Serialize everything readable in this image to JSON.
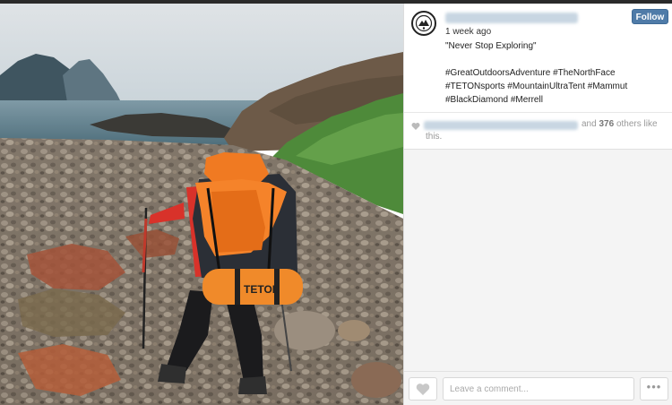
{
  "post": {
    "username": "",
    "follow_label": "Follow",
    "timestamp": "1 week ago",
    "caption_quote": "\"Never Stop Exploring\"",
    "hashtags_line1": "#GreatOutdoorsAdventure #TheNorthFace",
    "hashtags_line2": "#TETONsports #MountainUltraTent #Mammut",
    "hashtags_line3": "#BlackDiamond #Merrell"
  },
  "likes": {
    "and_text": "and",
    "count": "376",
    "others_text": "others like",
    "this_text": "this."
  },
  "comment": {
    "placeholder": "Leave a comment...",
    "more_label": "•••"
  },
  "photo": {
    "backpack_brand": "TETON"
  },
  "colors": {
    "follow_button": "#4f7ba8",
    "pack_orange": "#f07a22"
  }
}
